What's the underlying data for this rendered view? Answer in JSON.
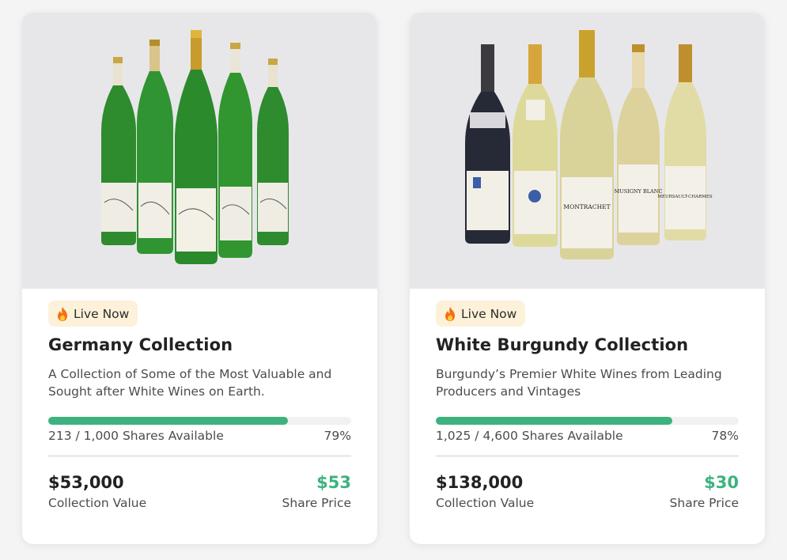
{
  "cards": [
    {
      "badge": {
        "icon": "fire-icon",
        "label": "Live Now"
      },
      "title": "Germany Collection",
      "description": "A Collection of Some of the Most Valuable and Sought after White Wines on Earth.",
      "shares_text": "213 / 1,000 Shares Available",
      "percent_text": "79%",
      "progress": 0.79,
      "collection_value": "$53,000",
      "collection_value_label": "Collection Value",
      "share_price": "$53",
      "share_price_label": "Share Price"
    },
    {
      "badge": {
        "icon": "fire-icon",
        "label": "Live Now"
      },
      "title": "White Burgundy Collection",
      "description": "Burgundy’s Premier White Wines from Leading Producers and Vintages",
      "shares_text": "1,025 / 4,600 Shares Available",
      "percent_text": "78%",
      "progress": 0.78,
      "collection_value": "$138,000",
      "collection_value_label": "Collection Value",
      "share_price": "$30",
      "share_price_label": "Share Price"
    }
  ],
  "colors": {
    "accent_green": "#3db27e",
    "badge_bg": "#fdf1da",
    "image_bg": "#e7e7e9"
  }
}
